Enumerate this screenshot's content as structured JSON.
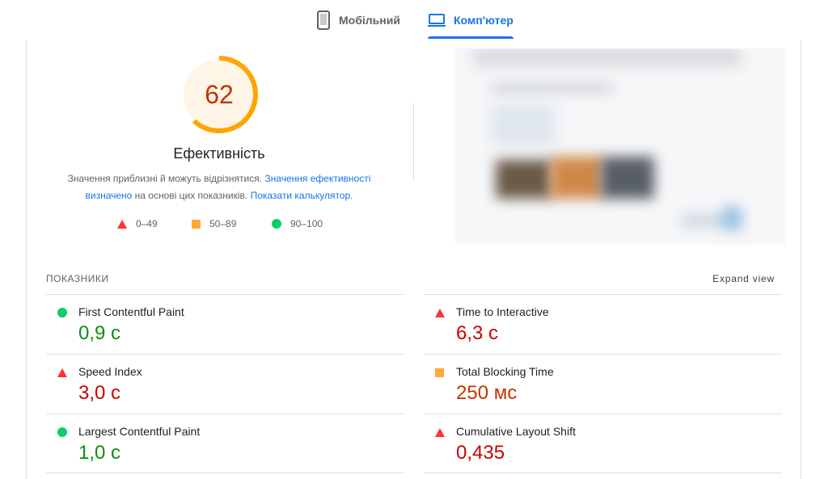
{
  "tabs": [
    {
      "label": "Мобільний",
      "active": false
    },
    {
      "label": "Комп'ютер",
      "active": true
    }
  ],
  "gauge": {
    "score": "62",
    "fraction": 0.62,
    "title": "Ефективність",
    "color": "#ffa400"
  },
  "note": {
    "part1": "Значення приблизні й можуть відрізнятися. ",
    "link1": "Значення ефективності визначено",
    "part2": " на основі цих показників. ",
    "link2": "Показати калькулятор",
    "part3": "."
  },
  "legend": [
    {
      "range": "0–49",
      "shape": "triangle",
      "color": "#ff3333"
    },
    {
      "range": "50–89",
      "shape": "square",
      "color": "#ffaa33"
    },
    {
      "range": "90–100",
      "shape": "circle",
      "color": "#0cce6b"
    }
  ],
  "metrics_header": "ПОКАЗНИКИ",
  "expand_label": "Expand view",
  "metrics": [
    {
      "name": "First Contentful Paint",
      "value": "0,9 с",
      "status": "good"
    },
    {
      "name": "Time to Interactive",
      "value": "6,3 с",
      "status": "bad"
    },
    {
      "name": "Speed Index",
      "value": "3,0 с",
      "status": "bad"
    },
    {
      "name": "Total Blocking Time",
      "value": "250 мс",
      "status": "average"
    },
    {
      "name": "Largest Contentful Paint",
      "value": "1,0 с",
      "status": "good"
    },
    {
      "name": "Cumulative Layout Shift",
      "value": "0,435",
      "status": "bad"
    }
  ],
  "colors": {
    "good": "#0cce6b",
    "average": "#ffaa33",
    "bad": "#ff3333",
    "accent": "#1a73e8"
  }
}
